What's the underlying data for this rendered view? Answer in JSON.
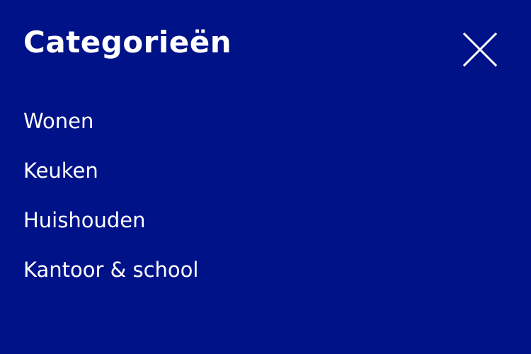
{
  "menu": {
    "title": "Categorieën",
    "close_icon": "close-icon",
    "colors": {
      "background": "#001288",
      "text": "#ffffff"
    },
    "items": [
      {
        "label": "Wonen"
      },
      {
        "label": "Keuken"
      },
      {
        "label": "Huishouden"
      },
      {
        "label": "Kantoor & school"
      }
    ]
  }
}
